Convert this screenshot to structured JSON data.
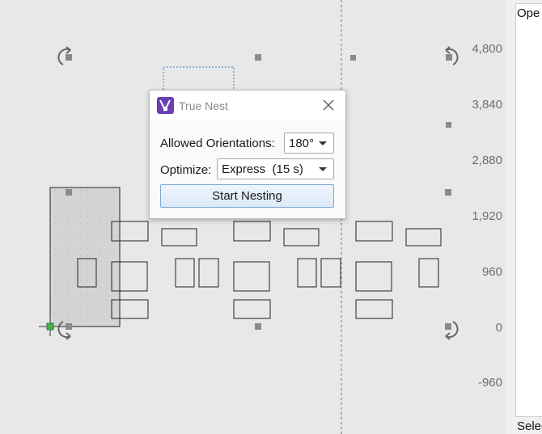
{
  "canvas": {
    "ruler_labels": [
      "4,800",
      "3,840",
      "2,880",
      "1,920",
      "960",
      "0",
      "-960"
    ]
  },
  "right_panel": {
    "header_text": "Ope",
    "footer_text": "Selec"
  },
  "dialog": {
    "title": "True Nest",
    "allowed_orientations_label": "Allowed Orientations:",
    "allowed_orientations_value": "180°",
    "optimize_label": "Optimize:",
    "optimize_value": "Express  (15 s)",
    "start_button_label": "Start Nesting"
  },
  "colors": {
    "accent": "#6a3fb5",
    "origin_marker": "#4caf50"
  }
}
